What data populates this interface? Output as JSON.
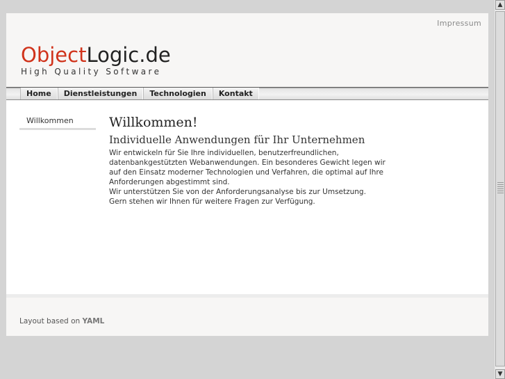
{
  "header": {
    "impressum": "Impressum",
    "logo_part1": "Object",
    "logo_part2": "Logic.de",
    "tagline": "High Quality Software"
  },
  "nav": {
    "items": [
      {
        "label": "Home"
      },
      {
        "label": "Dienstleistungen"
      },
      {
        "label": "Technologien"
      },
      {
        "label": "Kontakt"
      }
    ]
  },
  "sidebar": {
    "items": [
      {
        "label": "Willkommen"
      }
    ]
  },
  "main": {
    "title": "Willkommen!",
    "subtitle": "Individuelle Anwendungen für Ihr Unternehmen",
    "paragraph1": "Wir entwickeln für Sie Ihre individuellen, benutzerfreundlichen, datenbankgestützten Webanwendungen. Ein besonderes Gewicht legen wir auf den Einsatz moderner Technologien und Verfahren, die optimal auf Ihre Anforderungen abgestimmt sind.",
    "paragraph2": "Wir unterstützen Sie von der Anforderungsanalyse bis zur Umsetzung.",
    "paragraph3": "Gern stehen wir Ihnen für weitere Fragen zur Verfügung."
  },
  "footer": {
    "text": "Layout based on",
    "link": "YAML"
  },
  "colors": {
    "accent": "#d0331b",
    "header_bg": "#f7f6f5",
    "outer_bg": "#d4d4d4"
  },
  "icons": {
    "scroll_up": "arrow-up-icon",
    "scroll_down": "arrow-down-icon"
  }
}
